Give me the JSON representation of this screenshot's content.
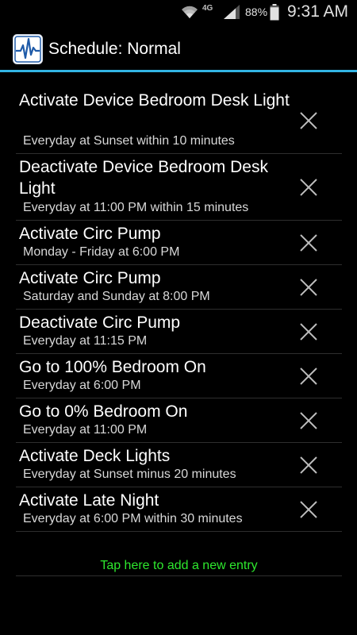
{
  "status_bar": {
    "network": "4G",
    "battery": "88%",
    "time": "9:31 AM"
  },
  "action_bar": {
    "title": "Schedule: Normal",
    "logo_icon": "pulse-waveform-logo"
  },
  "colors": {
    "accent": "#33b5e5",
    "add_entry_text": "#2ee82e"
  },
  "entries": [
    {
      "title": "Activate Device Bedroom Desk Light",
      "schedule": "Everyday at Sunset within 10 minutes"
    },
    {
      "title": "Deactivate Device Bedroom Desk Light",
      "schedule": "Everyday at 11:00 PM within 15 minutes"
    },
    {
      "title": "Activate Circ Pump",
      "schedule": "Monday - Friday at 6:00 PM"
    },
    {
      "title": "Activate Circ Pump",
      "schedule": "Saturday and Sunday at 8:00 PM"
    },
    {
      "title": "Deactivate Circ Pump",
      "schedule": "Everyday at 11:15 PM"
    },
    {
      "title": "Go to 100% Bedroom On",
      "schedule": "Everyday at 6:00 PM"
    },
    {
      "title": "Go to 0% Bedroom On",
      "schedule": "Everyday at 11:00 PM"
    },
    {
      "title": "Activate Deck Lights",
      "schedule": "Everyday at Sunset minus 20 minutes"
    },
    {
      "title": "Activate Late Night",
      "schedule": "Everyday at 6:00 PM within 30 minutes"
    }
  ],
  "add_entry_label": "Tap here to add a new entry"
}
